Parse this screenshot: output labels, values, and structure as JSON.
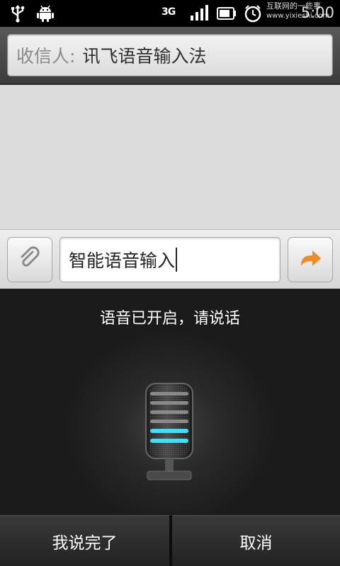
{
  "status_bar": {
    "network_label": "3G",
    "time": "5:00",
    "watermark_line1": "互联网的一些事",
    "watermark_line2": "www.yixieshi.com",
    "icons": [
      "usb-icon",
      "android-debug-icon",
      "3g-icon",
      "signal-icon",
      "battery-icon",
      "alarm-icon"
    ]
  },
  "recipient": {
    "label": "收信人:",
    "value": "讯飞语音输入法"
  },
  "compose": {
    "input_value": "智能语音输入",
    "send_icon_color": "#f08a22"
  },
  "voice": {
    "status_text": "语音已开启，请说话",
    "level_color": "#3fe0f5"
  },
  "buttons": {
    "done_label": "我说完了",
    "cancel_label": "取消"
  }
}
